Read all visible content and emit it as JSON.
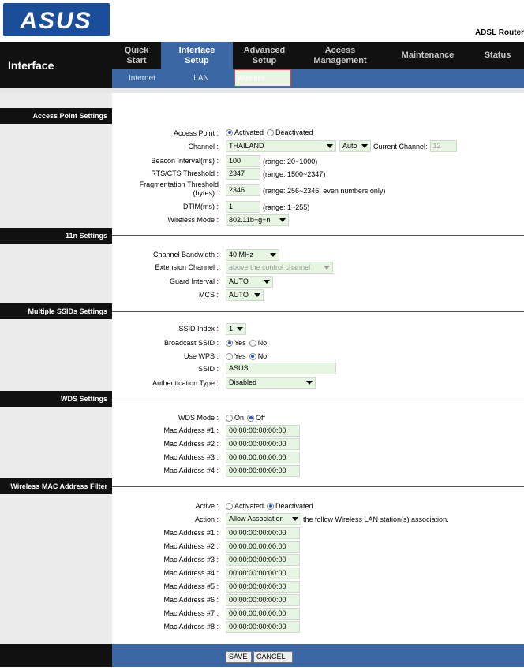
{
  "header": {
    "logo_text": "ASUS",
    "model": "ADSL Router",
    "section_title": "Interface"
  },
  "tabs": [
    {
      "label": "Quick\nStart"
    },
    {
      "label": "Interface\nSetup"
    },
    {
      "label": "Advanced\nSetup"
    },
    {
      "label": "Access\nManagement"
    },
    {
      "label": "Maintenance"
    },
    {
      "label": "Status"
    }
  ],
  "subtabs": [
    "Internet",
    "LAN",
    "Wireless"
  ],
  "ap": {
    "title": "Access Point Settings",
    "access_point_label": "Access Point :",
    "activated": "Activated",
    "deactivated": "Deactivated",
    "channel_label": "Channel :",
    "channel_value": "THAILAND",
    "channel_auto": "Auto",
    "current_channel_label": "Current Channel:",
    "current_channel_value": "12",
    "beacon_label": "Beacon Interval(ms) :",
    "beacon_value": "100",
    "beacon_range": "(range: 20~1000)",
    "rts_label": "RTS/CTS Threshold :",
    "rts_value": "2347",
    "rts_range": "(range: 1500~2347)",
    "frag_label_1": "Fragmentation Threshold",
    "frag_label_2": "(bytes) :",
    "frag_value": "2346",
    "frag_range": "(range: 256~2346, even numbers only)",
    "dtim_label": "DTIM(ms) :",
    "dtim_value": "1",
    "dtim_range": "(range: 1~255)",
    "mode_label": "Wireless Mode :",
    "mode_value": "802.11b+g+n"
  },
  "n11": {
    "title": "11n Settings",
    "bw_label": "Channel Bandwidth :",
    "bw_value": "40 MHz",
    "ext_label": "Extension Channel :",
    "ext_value": "above the control channel",
    "guard_label": "Guard Interval :",
    "guard_value": "AUTO",
    "mcs_label": "MCS :",
    "mcs_value": "AUTO"
  },
  "ssid": {
    "title": "Multiple SSIDs Settings",
    "index_label": "SSID Index :",
    "index_value": "1",
    "broadcast_label": "Broadcast SSID :",
    "yes": "Yes",
    "no": "No",
    "wps_label": "Use WPS :",
    "ssid_label": "SSID :",
    "ssid_value": "ASUS",
    "auth_label": "Authentication Type :",
    "auth_value": "Disabled"
  },
  "wds": {
    "title": "WDS Settings",
    "mode_label": "WDS Mode :",
    "on": "On",
    "off": "Off",
    "macs": [
      {
        "label": "Mac Address #1 :",
        "value": "00:00:00:00:00:00"
      },
      {
        "label": "Mac Address #2 :",
        "value": "00:00:00:00:00:00"
      },
      {
        "label": "Mac Address #3 :",
        "value": "00:00:00:00:00:00"
      },
      {
        "label": "Mac Address #4 :",
        "value": "00:00:00:00:00:00"
      }
    ]
  },
  "filter": {
    "title": "Wireless MAC Address Filter",
    "active_label": "Active :",
    "activated": "Activated",
    "deactivated": "Deactivated",
    "action_label": "Action :",
    "action_value": "Allow Association",
    "action_suffix": "the follow Wireless LAN station(s) association.",
    "macs": [
      {
        "label": "Mac Address #1 :",
        "value": "00:00:00:00:00:00"
      },
      {
        "label": "Mac Address #2 :",
        "value": "00:00:00:00:00:00"
      },
      {
        "label": "Mac Address #3 :",
        "value": "00:00:00:00:00:00"
      },
      {
        "label": "Mac Address #4 :",
        "value": "00:00:00:00:00:00"
      },
      {
        "label": "Mac Address #5 :",
        "value": "00:00:00:00:00:00"
      },
      {
        "label": "Mac Address #6 :",
        "value": "00:00:00:00:00:00"
      },
      {
        "label": "Mac Address #7 :",
        "value": "00:00:00:00:00:00"
      },
      {
        "label": "Mac Address #8 :",
        "value": "00:00:00:00:00:00"
      }
    ]
  },
  "buttons": {
    "save": "SAVE",
    "cancel": "CANCEL"
  }
}
